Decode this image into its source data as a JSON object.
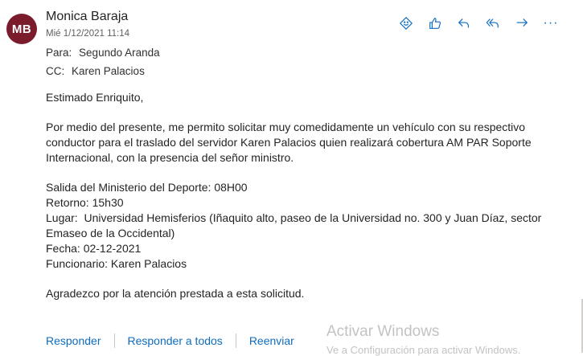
{
  "sender": {
    "initials": "MB",
    "name": "Monica Baraja",
    "date": "Mié 1/12/2021 11:14",
    "avatar_color": "#7a1c2c"
  },
  "recipients": {
    "to_label": "Para:",
    "to": "Segundo Aranda",
    "cc_label": "CC:",
    "cc": "Karen Palacios"
  },
  "toolbar": {
    "icons": [
      "sticker-icon",
      "like-icon",
      "reply-icon",
      "reply-all-icon",
      "forward-icon",
      "more-icon"
    ],
    "more_label": "···"
  },
  "body": {
    "greeting": "Estimado Enriquito,",
    "paragraph1": "Por medio del presente, me permito solicitar muy comedidamente un vehículo con su respectivo conductor para el traslado del servidor Karen Palacios quien realizará cobertura AM PAR Soporte Internacional, con la presencia del señor ministro.",
    "details": [
      "Salida del Ministerio del Deporte: 08H00",
      "Retorno: 15h30",
      "Lugar:  Universidad Hemisferios (Iñaquito alto, paseo de la Universidad no. 300 y Juan Díaz, sector Emaseo de la Occidental)",
      "Fecha: 02-12-2021",
      "Funcionario: Karen Palacios"
    ],
    "closing": "Agradezco por la atención prestada a esta solicitud."
  },
  "actions": {
    "reply": "Responder",
    "reply_all": "Responder a todos",
    "forward": "Reenviar"
  },
  "watermark": {
    "title": "Activar Windows",
    "subtitle": "Ve a Configuración para activar Windows."
  },
  "colors": {
    "accent": "#0f6cbd",
    "text": "#252423",
    "muted": "#605e5c"
  }
}
